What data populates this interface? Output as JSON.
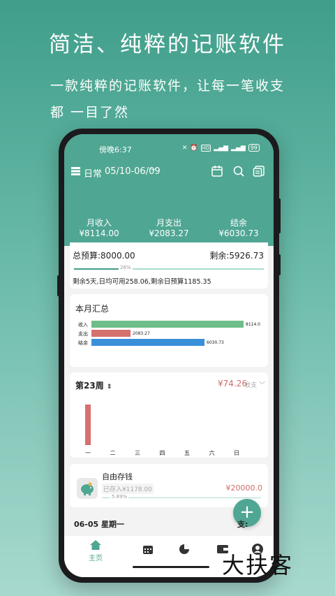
{
  "promo": {
    "title": "简洁、纯粹的记账软件",
    "subtitle_line1": "一款纯粹的记账软件，让每一笔收支",
    "subtitle_line2": "都 一目了然"
  },
  "status_bar": {
    "time": "傍晚6:37",
    "battery": "99"
  },
  "topbar": {
    "book": "日常",
    "date_range": "05/10-06/09"
  },
  "summary": {
    "income_label": "月收入",
    "income_value": "¥8114.00",
    "expense_label": "月支出",
    "expense_value": "¥2083.27",
    "balance_label": "结余",
    "balance_value": "¥6030.73"
  },
  "budget": {
    "total": "总预算:8000.00",
    "remaining": "剩余:5926.73",
    "percent_label": "26%",
    "percent": 26,
    "note": "剩余5天,日均可用258.06,剩余日预算1185.35"
  },
  "monthly": {
    "title": "本月汇总",
    "rows": [
      {
        "label": "收入",
        "value": 8114.0,
        "value_text": "8114.0"
      },
      {
        "label": "支出",
        "value": 2083.27,
        "value_text": "2083.27"
      },
      {
        "label": "结余",
        "value": 6030.73,
        "value_text": "6030.73"
      }
    ]
  },
  "weekly": {
    "title": "第23周",
    "amount": "¥74.26",
    "type": "收支",
    "days": [
      "一",
      "二",
      "三",
      "四",
      "五",
      "六",
      "日"
    ],
    "values": [
      74.26,
      0,
      0,
      0,
      0,
      0,
      0
    ]
  },
  "saving": {
    "name": "自由存钱",
    "saved": "已存入¥1178.00",
    "goal": "¥20000.0",
    "percent_label": "5.89%"
  },
  "day_group": {
    "date": "06-05 星期一",
    "expense_label": "支:"
  },
  "nav": {
    "home": "主页"
  },
  "colors": {
    "accent": "#4fa692",
    "income_bar": "#6dbe8a",
    "expense_bar": "#d5706e",
    "balance_bar": "#3a8fd9"
  },
  "watermark": "大扶客"
}
